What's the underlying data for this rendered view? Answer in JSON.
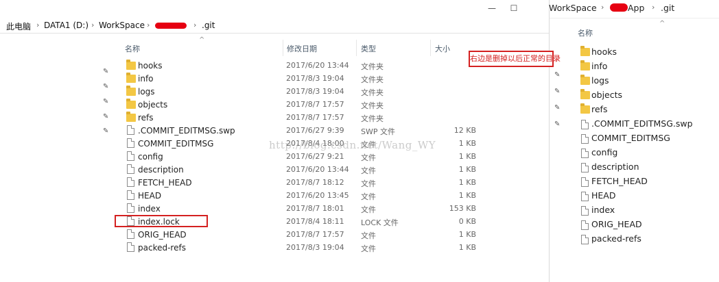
{
  "left_window": {
    "breadcrumb": [
      "此电脑",
      "DATA1 (D:)",
      "WorkSpace",
      "",
      ".git"
    ],
    "controls": {
      "minimize": "—",
      "maximize": "☐"
    },
    "columns": {
      "name": "名称",
      "date": "修改日期",
      "type": "类型",
      "size": "大小"
    },
    "files": [
      {
        "name": "hooks",
        "date": "2017/6/20 13:44",
        "type": "文件夹",
        "size": "",
        "icon": "folder-icon"
      },
      {
        "name": "info",
        "date": "2017/8/3 19:04",
        "type": "文件夹",
        "size": "",
        "icon": "folder-icon"
      },
      {
        "name": "logs",
        "date": "2017/8/3 19:04",
        "type": "文件夹",
        "size": "",
        "icon": "folder-icon"
      },
      {
        "name": "objects",
        "date": "2017/8/7 17:57",
        "type": "文件夹",
        "size": "",
        "icon": "folder-icon"
      },
      {
        "name": "refs",
        "date": "2017/8/7 17:57",
        "type": "文件夹",
        "size": "",
        "icon": "folder-icon"
      },
      {
        "name": ".COMMIT_EDITMSG.swp",
        "date": "2017/6/27 9:39",
        "type": "SWP 文件",
        "size": "12 KB",
        "icon": "file-icon"
      },
      {
        "name": "COMMIT_EDITMSG",
        "date": "2017/8/4 18:00",
        "type": "文件",
        "size": "1 KB",
        "icon": "file-icon"
      },
      {
        "name": "config",
        "date": "2017/6/27 9:21",
        "type": "文件",
        "size": "1 KB",
        "icon": "file-icon"
      },
      {
        "name": "description",
        "date": "2017/6/20 13:44",
        "type": "文件",
        "size": "1 KB",
        "icon": "file-icon"
      },
      {
        "name": "FETCH_HEAD",
        "date": "2017/8/7 18:12",
        "type": "文件",
        "size": "1 KB",
        "icon": "file-icon"
      },
      {
        "name": "HEAD",
        "date": "2017/6/20 13:45",
        "type": "文件",
        "size": "1 KB",
        "icon": "file-icon"
      },
      {
        "name": "index",
        "date": "2017/8/7 18:01",
        "type": "文件",
        "size": "153 KB",
        "icon": "file-icon"
      },
      {
        "name": "index.lock",
        "date": "2017/8/4 18:11",
        "type": "LOCK 文件",
        "size": "0 KB",
        "icon": "file-icon"
      },
      {
        "name": "ORIG_HEAD",
        "date": "2017/8/7 17:57",
        "type": "文件",
        "size": "1 KB",
        "icon": "file-icon"
      },
      {
        "name": "packed-refs",
        "date": "2017/8/3 19:04",
        "type": "文件",
        "size": "1 KB",
        "icon": "file-icon"
      }
    ]
  },
  "annotation": {
    "note": "右边是删掉以后正常的目录",
    "highlighted_file": "index.lock",
    "color": "#d42020"
  },
  "watermark": "http://blog.csdn.net/Wang_WY",
  "right_window": {
    "breadcrumb": [
      "WorkSpace",
      "App",
      ".git"
    ],
    "column_name": "名称",
    "files": [
      {
        "name": "hooks",
        "icon": "folder-icon"
      },
      {
        "name": "info",
        "icon": "folder-icon"
      },
      {
        "name": "logs",
        "icon": "folder-icon"
      },
      {
        "name": "objects",
        "icon": "folder-icon"
      },
      {
        "name": "refs",
        "icon": "folder-icon"
      },
      {
        "name": ".COMMIT_EDITMSG.swp",
        "icon": "file-icon"
      },
      {
        "name": "COMMIT_EDITMSG",
        "icon": "file-icon"
      },
      {
        "name": "config",
        "icon": "file-icon"
      },
      {
        "name": "description",
        "icon": "file-icon"
      },
      {
        "name": "FETCH_HEAD",
        "icon": "file-icon"
      },
      {
        "name": "HEAD",
        "icon": "file-icon"
      },
      {
        "name": "index",
        "icon": "file-icon"
      },
      {
        "name": "ORIG_HEAD",
        "icon": "file-icon"
      },
      {
        "name": "packed-refs",
        "icon": "file-icon"
      }
    ]
  }
}
